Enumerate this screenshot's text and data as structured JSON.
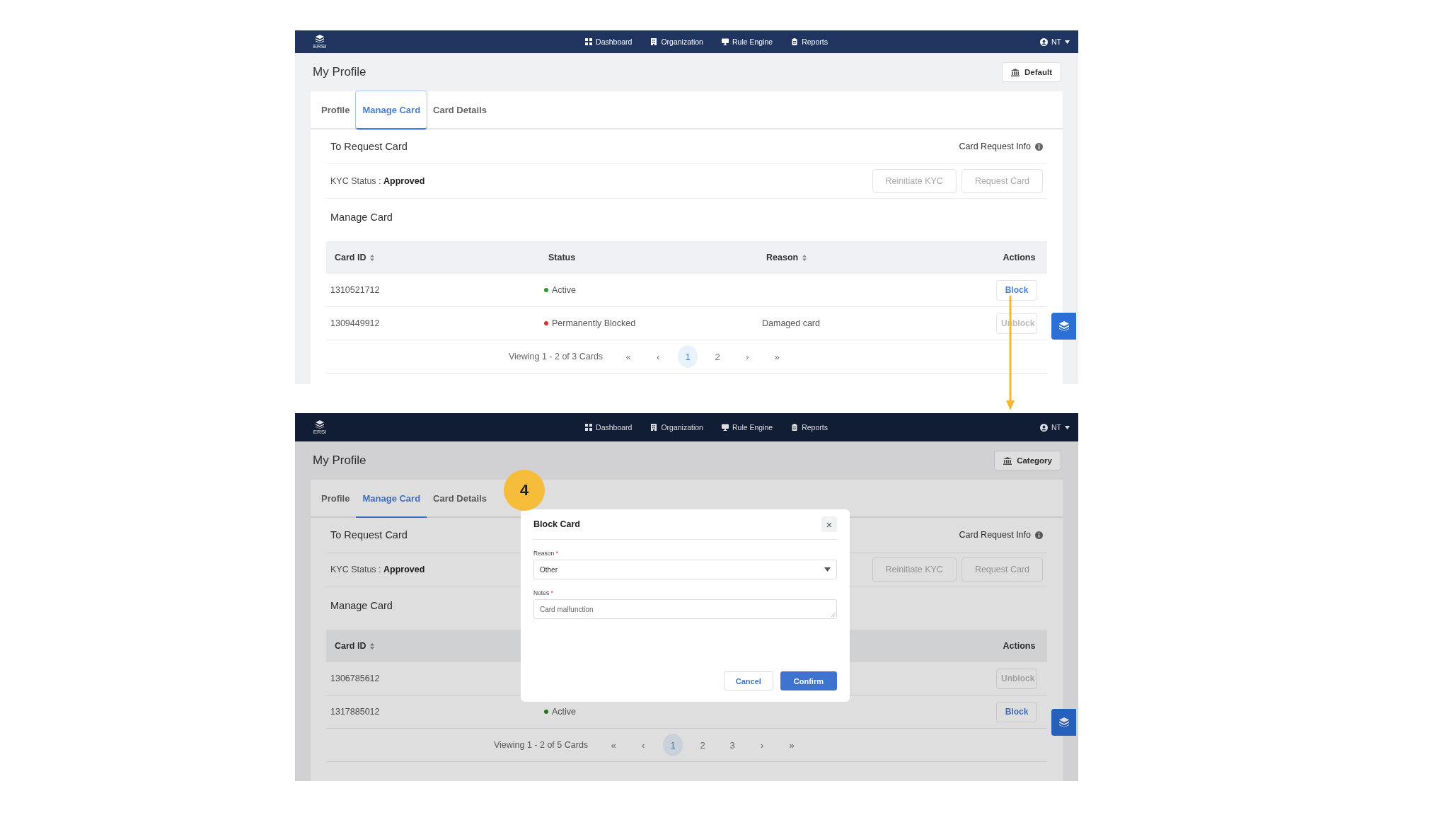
{
  "screens": [
    {
      "nav": {
        "logo": "ERSI",
        "items": [
          {
            "label": "Dashboard"
          },
          {
            "label": "Organization"
          },
          {
            "label": "Rule Engine"
          },
          {
            "label": "Reports"
          }
        ],
        "user": "NT"
      },
      "page_title": "My Profile",
      "header_button": "Default",
      "tabs": [
        {
          "label": "Profile",
          "selected": false
        },
        {
          "label": "Manage Card",
          "selected": true
        },
        {
          "label": "Card Details",
          "selected": false
        }
      ],
      "request_section": {
        "title": "To Request Card",
        "info_link": "Card Request Info",
        "kyc_label": "KYC Status :",
        "kyc_value": "Approved",
        "buttons": [
          "Reinitiate KYC",
          "Request Card"
        ]
      },
      "manage_title": "Manage Card",
      "table": {
        "columns": [
          {
            "label": "Card ID",
            "sortable": true
          },
          {
            "label": "Status",
            "sortable": false
          },
          {
            "label": "Reason",
            "sortable": true
          },
          {
            "label": "Actions",
            "sortable": false
          }
        ],
        "rows": [
          {
            "card_id": "1310521712",
            "status": {
              "label": "Active",
              "color": "#2e9a2e"
            },
            "action": {
              "label": "Block",
              "disabled": false
            }
          },
          {
            "card_id": "1309449912",
            "status": {
              "label": "Permanently Blocked",
              "color": "#d9342b"
            },
            "reason": "Damaged card",
            "action": {
              "label": "Unblock",
              "disabled": true
            }
          }
        ]
      },
      "pagination": {
        "summary": "Viewing 1 - 2 of 3 Cards",
        "first": "«",
        "prev": "‹",
        "next": "›",
        "last": "»",
        "pages": [
          {
            "label": "1",
            "selected": true
          },
          {
            "label": "2",
            "selected": false
          }
        ]
      }
    },
    {
      "nav": {
        "logo": "ERSI",
        "items": [
          {
            "label": "Dashboard"
          },
          {
            "label": "Organization"
          },
          {
            "label": "Rule Engine"
          },
          {
            "label": "Reports"
          }
        ],
        "user": "NT"
      },
      "page_title": "My Profile",
      "header_button": "Category",
      "tabs": [
        {
          "label": "Profile",
          "selected": false
        },
        {
          "label": "Manage Card",
          "selected": true
        },
        {
          "label": "Card Details",
          "selected": false
        }
      ],
      "request_section": {
        "title": "To Request Card",
        "info_link": "Card Request Info",
        "kyc_label": "KYC Status :",
        "kyc_value": "Approved",
        "buttons": [
          "Reinitiate KYC",
          "Request Card"
        ]
      },
      "manage_title": "Manage Card",
      "table": {
        "columns": [
          {
            "label": "Card ID",
            "sortable": true
          },
          {},
          {},
          {
            "label": "Actions",
            "sortable": false
          }
        ],
        "rows": [
          {
            "card_id": "1306785612",
            "action": {
              "label": "Unblock",
              "disabled": true
            }
          },
          {
            "card_id": "1317885012",
            "status": {
              "label": "Active",
              "color": "#288628"
            },
            "action": {
              "label": "Block",
              "disabled": false
            }
          }
        ]
      },
      "pagination": {
        "summary": "Viewing 1 - 2 of 5 Cards",
        "first": "«",
        "prev": "‹",
        "next": "›",
        "last": "»",
        "pages": [
          {
            "label": "1",
            "selected": true
          },
          {
            "label": "2",
            "selected": false
          },
          {
            "label": "3",
            "selected": false
          }
        ]
      },
      "modal": {
        "title": "Block Card",
        "close": "×",
        "fields": [
          {
            "kind": "select",
            "label": "Reason",
            "required_mark": "*",
            "value": "Other"
          },
          {
            "kind": "textarea",
            "label": "Notes",
            "required_mark": "*",
            "value": "Card malfunction"
          }
        ],
        "buttons": [
          {
            "label": "Cancel",
            "primary": false
          },
          {
            "label": "Confirm",
            "primary": true
          }
        ]
      }
    }
  ],
  "callout": {
    "step": "4"
  }
}
